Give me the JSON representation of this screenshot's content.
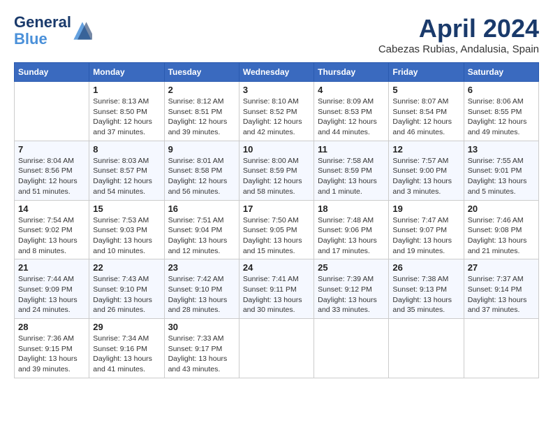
{
  "header": {
    "logo_line1": "General",
    "logo_line2": "Blue",
    "month": "April 2024",
    "location": "Cabezas Rubias, Andalusia, Spain"
  },
  "days_of_week": [
    "Sunday",
    "Monday",
    "Tuesday",
    "Wednesday",
    "Thursday",
    "Friday",
    "Saturday"
  ],
  "weeks": [
    [
      {
        "day": "",
        "info": ""
      },
      {
        "day": "1",
        "info": "Sunrise: 8:13 AM\nSunset: 8:50 PM\nDaylight: 12 hours\nand 37 minutes."
      },
      {
        "day": "2",
        "info": "Sunrise: 8:12 AM\nSunset: 8:51 PM\nDaylight: 12 hours\nand 39 minutes."
      },
      {
        "day": "3",
        "info": "Sunrise: 8:10 AM\nSunset: 8:52 PM\nDaylight: 12 hours\nand 42 minutes."
      },
      {
        "day": "4",
        "info": "Sunrise: 8:09 AM\nSunset: 8:53 PM\nDaylight: 12 hours\nand 44 minutes."
      },
      {
        "day": "5",
        "info": "Sunrise: 8:07 AM\nSunset: 8:54 PM\nDaylight: 12 hours\nand 46 minutes."
      },
      {
        "day": "6",
        "info": "Sunrise: 8:06 AM\nSunset: 8:55 PM\nDaylight: 12 hours\nand 49 minutes."
      }
    ],
    [
      {
        "day": "7",
        "info": "Sunrise: 8:04 AM\nSunset: 8:56 PM\nDaylight: 12 hours\nand 51 minutes."
      },
      {
        "day": "8",
        "info": "Sunrise: 8:03 AM\nSunset: 8:57 PM\nDaylight: 12 hours\nand 54 minutes."
      },
      {
        "day": "9",
        "info": "Sunrise: 8:01 AM\nSunset: 8:58 PM\nDaylight: 12 hours\nand 56 minutes."
      },
      {
        "day": "10",
        "info": "Sunrise: 8:00 AM\nSunset: 8:59 PM\nDaylight: 12 hours\nand 58 minutes."
      },
      {
        "day": "11",
        "info": "Sunrise: 7:58 AM\nSunset: 8:59 PM\nDaylight: 13 hours\nand 1 minute."
      },
      {
        "day": "12",
        "info": "Sunrise: 7:57 AM\nSunset: 9:00 PM\nDaylight: 13 hours\nand 3 minutes."
      },
      {
        "day": "13",
        "info": "Sunrise: 7:55 AM\nSunset: 9:01 PM\nDaylight: 13 hours\nand 5 minutes."
      }
    ],
    [
      {
        "day": "14",
        "info": "Sunrise: 7:54 AM\nSunset: 9:02 PM\nDaylight: 13 hours\nand 8 minutes."
      },
      {
        "day": "15",
        "info": "Sunrise: 7:53 AM\nSunset: 9:03 PM\nDaylight: 13 hours\nand 10 minutes."
      },
      {
        "day": "16",
        "info": "Sunrise: 7:51 AM\nSunset: 9:04 PM\nDaylight: 13 hours\nand 12 minutes."
      },
      {
        "day": "17",
        "info": "Sunrise: 7:50 AM\nSunset: 9:05 PM\nDaylight: 13 hours\nand 15 minutes."
      },
      {
        "day": "18",
        "info": "Sunrise: 7:48 AM\nSunset: 9:06 PM\nDaylight: 13 hours\nand 17 minutes."
      },
      {
        "day": "19",
        "info": "Sunrise: 7:47 AM\nSunset: 9:07 PM\nDaylight: 13 hours\nand 19 minutes."
      },
      {
        "day": "20",
        "info": "Sunrise: 7:46 AM\nSunset: 9:08 PM\nDaylight: 13 hours\nand 21 minutes."
      }
    ],
    [
      {
        "day": "21",
        "info": "Sunrise: 7:44 AM\nSunset: 9:09 PM\nDaylight: 13 hours\nand 24 minutes."
      },
      {
        "day": "22",
        "info": "Sunrise: 7:43 AM\nSunset: 9:10 PM\nDaylight: 13 hours\nand 26 minutes."
      },
      {
        "day": "23",
        "info": "Sunrise: 7:42 AM\nSunset: 9:10 PM\nDaylight: 13 hours\nand 28 minutes."
      },
      {
        "day": "24",
        "info": "Sunrise: 7:41 AM\nSunset: 9:11 PM\nDaylight: 13 hours\nand 30 minutes."
      },
      {
        "day": "25",
        "info": "Sunrise: 7:39 AM\nSunset: 9:12 PM\nDaylight: 13 hours\nand 33 minutes."
      },
      {
        "day": "26",
        "info": "Sunrise: 7:38 AM\nSunset: 9:13 PM\nDaylight: 13 hours\nand 35 minutes."
      },
      {
        "day": "27",
        "info": "Sunrise: 7:37 AM\nSunset: 9:14 PM\nDaylight: 13 hours\nand 37 minutes."
      }
    ],
    [
      {
        "day": "28",
        "info": "Sunrise: 7:36 AM\nSunset: 9:15 PM\nDaylight: 13 hours\nand 39 minutes."
      },
      {
        "day": "29",
        "info": "Sunrise: 7:34 AM\nSunset: 9:16 PM\nDaylight: 13 hours\nand 41 minutes."
      },
      {
        "day": "30",
        "info": "Sunrise: 7:33 AM\nSunset: 9:17 PM\nDaylight: 13 hours\nand 43 minutes."
      },
      {
        "day": "",
        "info": ""
      },
      {
        "day": "",
        "info": ""
      },
      {
        "day": "",
        "info": ""
      },
      {
        "day": "",
        "info": ""
      }
    ]
  ]
}
